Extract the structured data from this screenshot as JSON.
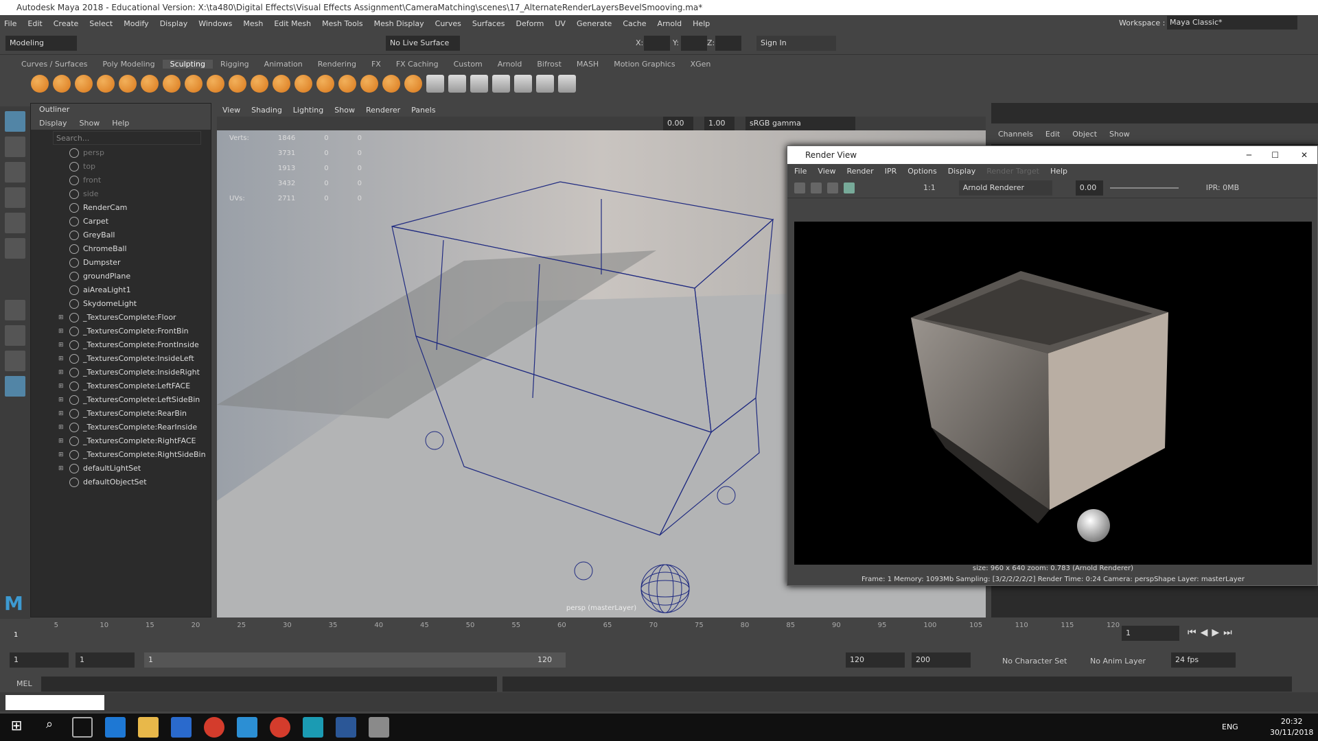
{
  "window": {
    "title": "Autodesk Maya 2018 - Educational Version: X:\\ta480\\Digital Effects\\Visual Effects Assignment\\CameraMatching\\scenes\\17_AlternateRenderLayersBevelSmooving.ma*"
  },
  "menubar": [
    "File",
    "Edit",
    "Create",
    "Select",
    "Modify",
    "Display",
    "Windows",
    "Mesh",
    "Edit Mesh",
    "Mesh Tools",
    "Mesh Display",
    "Curves",
    "Surfaces",
    "Deform",
    "UV",
    "Generate",
    "Cache",
    "Arnold",
    "Help"
  ],
  "workspace": {
    "label": "Workspace :",
    "value": "Maya Classic*"
  },
  "status": {
    "mode": "Modeling",
    "live_surface": "No Live Surface",
    "x": "X:",
    "y": "Y:",
    "z": "Z:",
    "sign_in": "Sign In"
  },
  "shelf_tabs": [
    "Curves / Surfaces",
    "Poly Modeling",
    "Sculpting",
    "Rigging",
    "Animation",
    "Rendering",
    "FX",
    "FX Caching",
    "Custom",
    "Arnold",
    "Bifrost",
    "MASH",
    "Motion Graphics",
    "XGen"
  ],
  "outliner": {
    "title": "Outliner",
    "menu": [
      "Display",
      "Show",
      "Help"
    ],
    "search_placeholder": "Search...",
    "items": [
      "persp",
      "top",
      "front",
      "side",
      "RenderCam",
      "Carpet",
      "GreyBall",
      "ChromeBall",
      "Dumpster",
      "groundPlane",
      "aiAreaLight1",
      "SkydomeLight",
      "_TexturesComplete:Floor",
      "_TexturesComplete:FrontBin",
      "_TexturesComplete:FrontInside",
      "_TexturesComplete:InsideLeft",
      "_TexturesComplete:InsideRight",
      "_TexturesComplete:LeftFACE",
      "_TexturesComplete:LeftSideBin",
      "_TexturesComplete:RearBin",
      "_TexturesComplete:RearInside",
      "_TexturesComplete:RightFACE",
      "_TexturesComplete:RightSideBin",
      "defaultLightSet",
      "defaultObjectSet"
    ]
  },
  "viewport": {
    "menu": [
      "View",
      "Shading",
      "Lighting",
      "Show",
      "Renderer",
      "Panels"
    ],
    "field1": "0.00",
    "field2": "1.00",
    "color_space": "sRGB gamma",
    "hud": [
      {
        "label": "Verts:",
        "a": "1846",
        "b": "0",
        "c": "0"
      },
      {
        "label": "",
        "a": "3731",
        "b": "0",
        "c": "0"
      },
      {
        "label": "",
        "a": "1913",
        "b": "0",
        "c": "0"
      },
      {
        "label": "",
        "a": "3432",
        "b": "0",
        "c": "0"
      },
      {
        "label": "UVs:",
        "a": "2711",
        "b": "0",
        "c": "0"
      }
    ],
    "camera_label": "persp (masterLayer)"
  },
  "channelbox": {
    "menu": [
      "Channels",
      "Edit",
      "Object",
      "Show"
    ]
  },
  "renderview": {
    "title": "Render View",
    "menu": [
      "File",
      "View",
      "Render",
      "IPR",
      "Options",
      "Display",
      "Render Target",
      "Help"
    ],
    "renderer": "Arnold Renderer",
    "exposure": "0.00",
    "ratio": "1:1",
    "ipr": "IPR: 0MB",
    "info1": "size: 960 x 640  zoom: 0.783     (Arnold Renderer)",
    "info2": "Frame: 1     Memory: 1093Mb     Sampling: [3/2/2/2/2/2]     Render Time: 0:24     Camera: perspShape     Layer: masterLayer"
  },
  "timeline": {
    "ticks": [
      "5",
      "10",
      "15",
      "20",
      "25",
      "30",
      "35",
      "40",
      "45",
      "50",
      "55",
      "60",
      "65",
      "70",
      "75",
      "80",
      "85",
      "90",
      "95",
      "100",
      "105",
      "110",
      "115",
      "120"
    ],
    "current": "1",
    "frame_field": "1"
  },
  "range": {
    "start": "1",
    "start2": "1",
    "inner_start": "1",
    "inner_end": "120",
    "end": "120",
    "end2": "200",
    "character_set": "No Character Set",
    "anim_layer": "No Anim Layer",
    "fps": "24 fps"
  },
  "cmd": {
    "lang": "MEL"
  },
  "taskbar": {
    "lang": "ENG",
    "time": "20:32",
    "date": "30/11/2018"
  }
}
